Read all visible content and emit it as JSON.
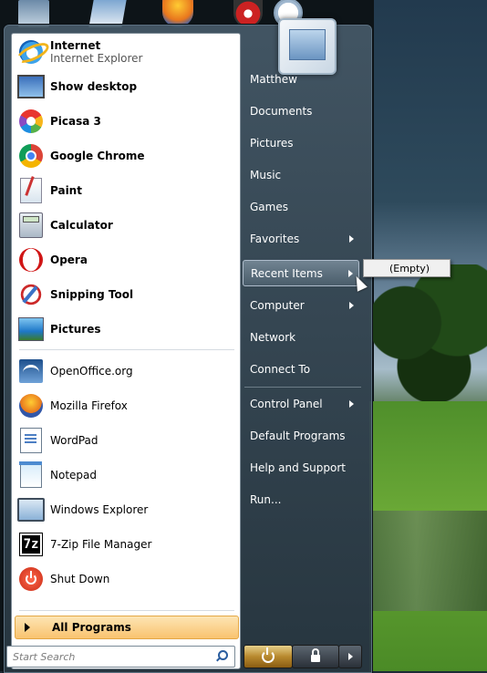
{
  "pinned_programs": [
    {
      "label": "Internet",
      "sub": "Internet Explorer",
      "icon": "internet-explorer-icon"
    },
    {
      "label": "Show desktop",
      "icon": "show-desktop-icon"
    }
  ],
  "recent_programs_bold": [
    {
      "label": "Picasa 3",
      "icon": "picasa-icon"
    },
    {
      "label": "Google Chrome",
      "icon": "chrome-icon"
    },
    {
      "label": "Paint",
      "icon": "paint-icon"
    },
    {
      "label": "Calculator",
      "icon": "calculator-icon"
    },
    {
      "label": "Opera",
      "icon": "opera-icon"
    },
    {
      "label": "Snipping Tool",
      "icon": "snipping-tool-icon"
    },
    {
      "label": "Pictures",
      "icon": "pictures-icon"
    }
  ],
  "recent_programs": [
    {
      "label": "OpenOffice.org",
      "icon": "openoffice-icon"
    },
    {
      "label": "Mozilla Firefox",
      "icon": "firefox-icon"
    },
    {
      "label": "WordPad",
      "icon": "wordpad-icon"
    },
    {
      "label": "Notepad",
      "icon": "notepad-icon"
    },
    {
      "label": "Windows Explorer",
      "icon": "windows-explorer-icon"
    },
    {
      "label": "7-Zip File Manager",
      "icon": "7zip-icon"
    },
    {
      "label": "Shut Down",
      "icon": "shut-down-icon"
    }
  ],
  "icon_text": {
    "seven_zip": "7z"
  },
  "all_programs": {
    "label": "All Programs"
  },
  "search": {
    "placeholder": "Start Search"
  },
  "right_menu": [
    {
      "label": "Matthew"
    },
    {
      "label": "Documents"
    },
    {
      "label": "Pictures"
    },
    {
      "label": "Music"
    },
    {
      "label": "Games"
    },
    {
      "label": "Favorites",
      "submenu": true
    },
    {
      "label": "Recent Items",
      "submenu": true,
      "active": true
    },
    {
      "label": "Computer",
      "submenu": true
    },
    {
      "label": "Network"
    },
    {
      "label": "Connect To"
    },
    {
      "label": "Control Panel",
      "submenu": true
    },
    {
      "label": "Default Programs"
    },
    {
      "label": "Help and Support"
    },
    {
      "label": "Run..."
    }
  ],
  "recent_items_flyout": {
    "label": "(Empty)"
  },
  "power_buttons": {
    "shutdown": "power-icon",
    "lock": "lock-icon",
    "more": "arrow-right-icon"
  },
  "colors": {
    "all_programs_highlight": "#f9c36f",
    "menu_glass": "#2e3d48",
    "left_pane": "#ffffff"
  }
}
